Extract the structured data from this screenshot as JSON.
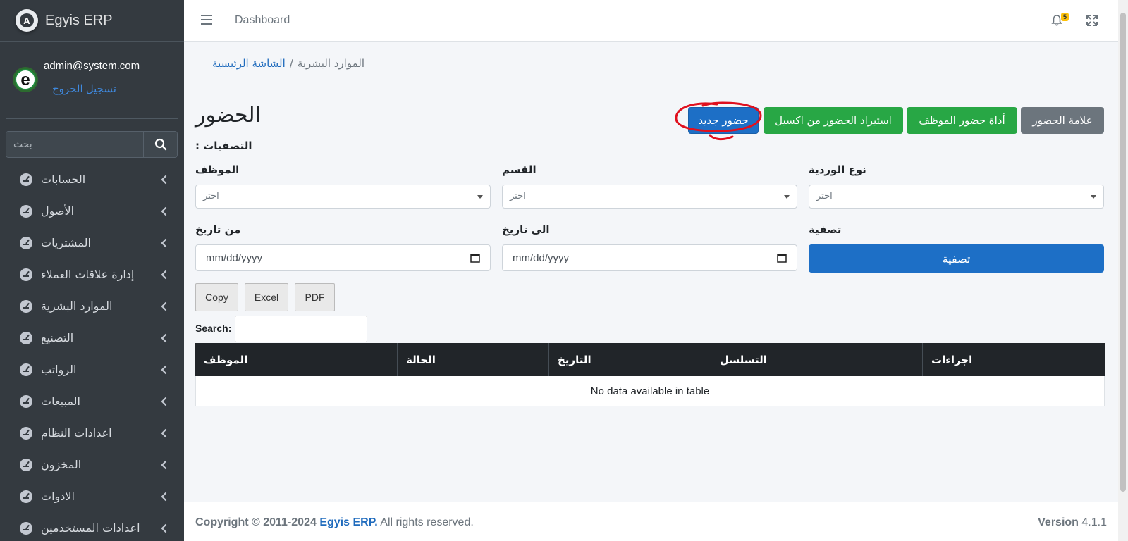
{
  "brand": {
    "name": "Egyis ERP",
    "logo_letter": "A"
  },
  "user": {
    "email": "admin@system.com",
    "logout_label": "تسجيل الخروج",
    "avatar_letter": "e"
  },
  "sidebar": {
    "search_placeholder": "بحث",
    "items": [
      {
        "label": "الحسابات"
      },
      {
        "label": "الأصول"
      },
      {
        "label": "المشتريات"
      },
      {
        "label": "إدارة علاقات العملاء"
      },
      {
        "label": "الموارد البشرية"
      },
      {
        "label": "التصنيع"
      },
      {
        "label": "الرواتب"
      },
      {
        "label": "المبيعات"
      },
      {
        "label": "اعدادات النظام"
      },
      {
        "label": "المخزون"
      },
      {
        "label": "الادوات"
      },
      {
        "label": "اعدادات المستخدمين"
      }
    ]
  },
  "header": {
    "dashboard_link": "Dashboard",
    "notification_count": "5"
  },
  "breadcrumb": {
    "home": "الشاشة الرئيسية",
    "separator": "/",
    "current": "الموارد البشرية"
  },
  "page": {
    "title": "الحضور",
    "filters_label": "التصفيات :"
  },
  "actions": {
    "mark_attendance": "علامة الحضور",
    "employee_attendance_tool": "أداة حضور الموظف",
    "import_excel": "استيراد الحضور من اكسيل",
    "new_attendance": "حضور جديد"
  },
  "filters": {
    "shift_type": {
      "label": "نوع الوردية",
      "placeholder": "اختر"
    },
    "department": {
      "label": "القسم",
      "placeholder": "اختر"
    },
    "employee": {
      "label": "الموظف",
      "placeholder": "اختر"
    },
    "filter_label": "تصفية",
    "to_date": {
      "label": "الى تاريخ",
      "value": "mm/dd/yyyy"
    },
    "from_date": {
      "label": "من تاريخ",
      "value": "mm/dd/yyyy"
    },
    "filter_button": "تصفية"
  },
  "datatable": {
    "buttons": [
      "Copy",
      "Excel",
      "PDF"
    ],
    "search_label": "Search:",
    "columns": [
      "الموظف",
      "الحالة",
      "التاريخ",
      "التسلسل",
      "اجراءات"
    ],
    "empty_message": "No data available in table"
  },
  "footer": {
    "copyright_prefix": "Copyright © 2011-2024",
    "company": "Egyis ERP.",
    "rights": "All rights reserved.",
    "version_label": "Version",
    "version_number": "4.1.1"
  },
  "colors": {
    "primary": "#1d6fc6",
    "success": "#28a745",
    "secondary": "#6c757d",
    "sidebar": "#343a40",
    "annotation": "#e0101e"
  }
}
